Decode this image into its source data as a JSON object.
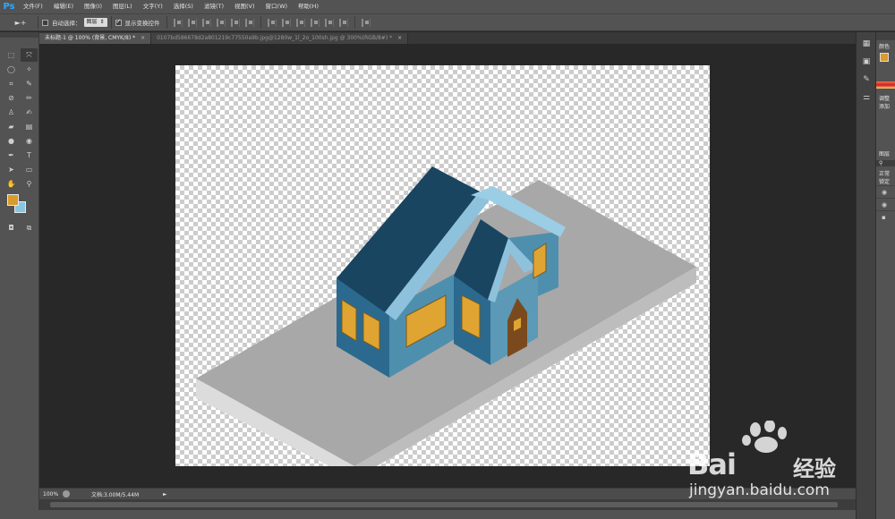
{
  "app": {
    "logo": "Ps"
  },
  "menu": [
    "文件(F)",
    "编辑(E)",
    "图像(I)",
    "图层(L)",
    "文字(Y)",
    "选择(S)",
    "滤镜(T)",
    "视图(V)",
    "窗口(W)",
    "帮助(H)"
  ],
  "options": {
    "tool_glyph": "►+",
    "auto_select_label": "自动选择：",
    "auto_select_value": "图层",
    "show_transform_label": "显示变换控件"
  },
  "tabs": [
    {
      "label": "未标题-1 @ 100% (背景, CMYK/8) *",
      "active": true
    },
    {
      "label": "0107bd586678d2a801219c77550a9b.jpg@1280w_1l_2o_100sh.jpg @ 300%(RGB/8#) *",
      "active": false
    }
  ],
  "status": {
    "zoom": "100%",
    "doc_info": "文档:3.00M/5.44M",
    "arrow": "►"
  },
  "colors": {
    "foreground": "#d99b2b",
    "background": "#87c5e0"
  },
  "right_panel": {
    "color_label": "颜色",
    "adjust_label": "调整",
    "add_label": "添加",
    "layers_label": "图层",
    "normal_label": "正常",
    "lock_label": "锁定"
  },
  "watermark": {
    "brand": "Bai",
    "brand_cn": "经验",
    "url": "jingyan.baidu.com"
  }
}
